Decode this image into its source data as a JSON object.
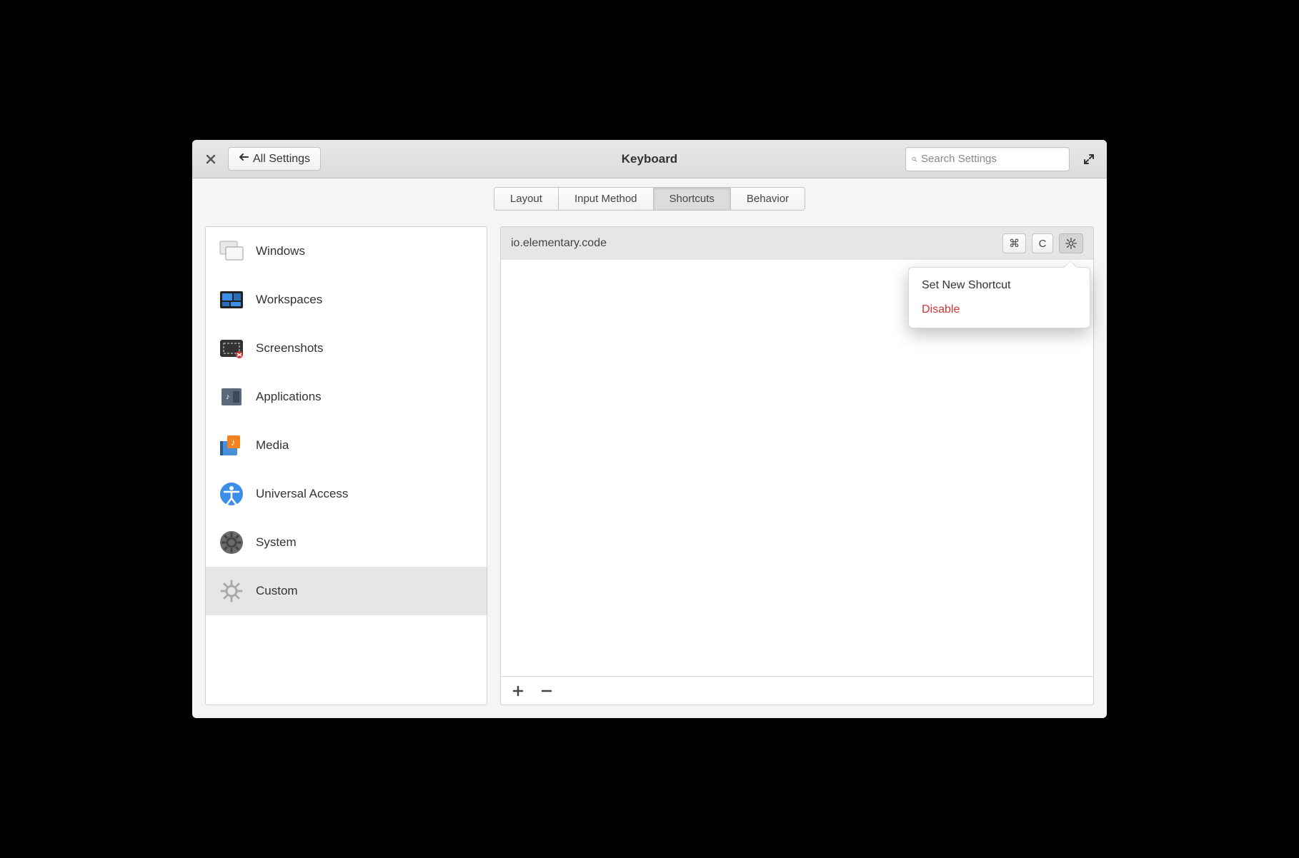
{
  "header": {
    "back_label": "All Settings",
    "title": "Keyboard",
    "search_placeholder": "Search Settings"
  },
  "tabs": [
    {
      "label": "Layout",
      "active": false
    },
    {
      "label": "Input Method",
      "active": false
    },
    {
      "label": "Shortcuts",
      "active": true
    },
    {
      "label": "Behavior",
      "active": false
    }
  ],
  "sidebar": {
    "items": [
      {
        "label": "Windows",
        "icon": "windows"
      },
      {
        "label": "Workspaces",
        "icon": "workspaces"
      },
      {
        "label": "Screenshots",
        "icon": "screenshots"
      },
      {
        "label": "Applications",
        "icon": "applications"
      },
      {
        "label": "Media",
        "icon": "media"
      },
      {
        "label": "Universal Access",
        "icon": "accessibility"
      },
      {
        "label": "System",
        "icon": "system"
      },
      {
        "label": "Custom",
        "icon": "custom"
      }
    ],
    "selected_index": 7
  },
  "shortcut_row": {
    "label": "io.elementary.code",
    "keys": [
      "⌘",
      "C"
    ]
  },
  "popover": {
    "items": [
      {
        "label": "Set New Shortcut",
        "danger": false
      },
      {
        "label": "Disable",
        "danger": true
      }
    ]
  },
  "toolbar": {
    "add_label": "+",
    "remove_label": "−"
  }
}
